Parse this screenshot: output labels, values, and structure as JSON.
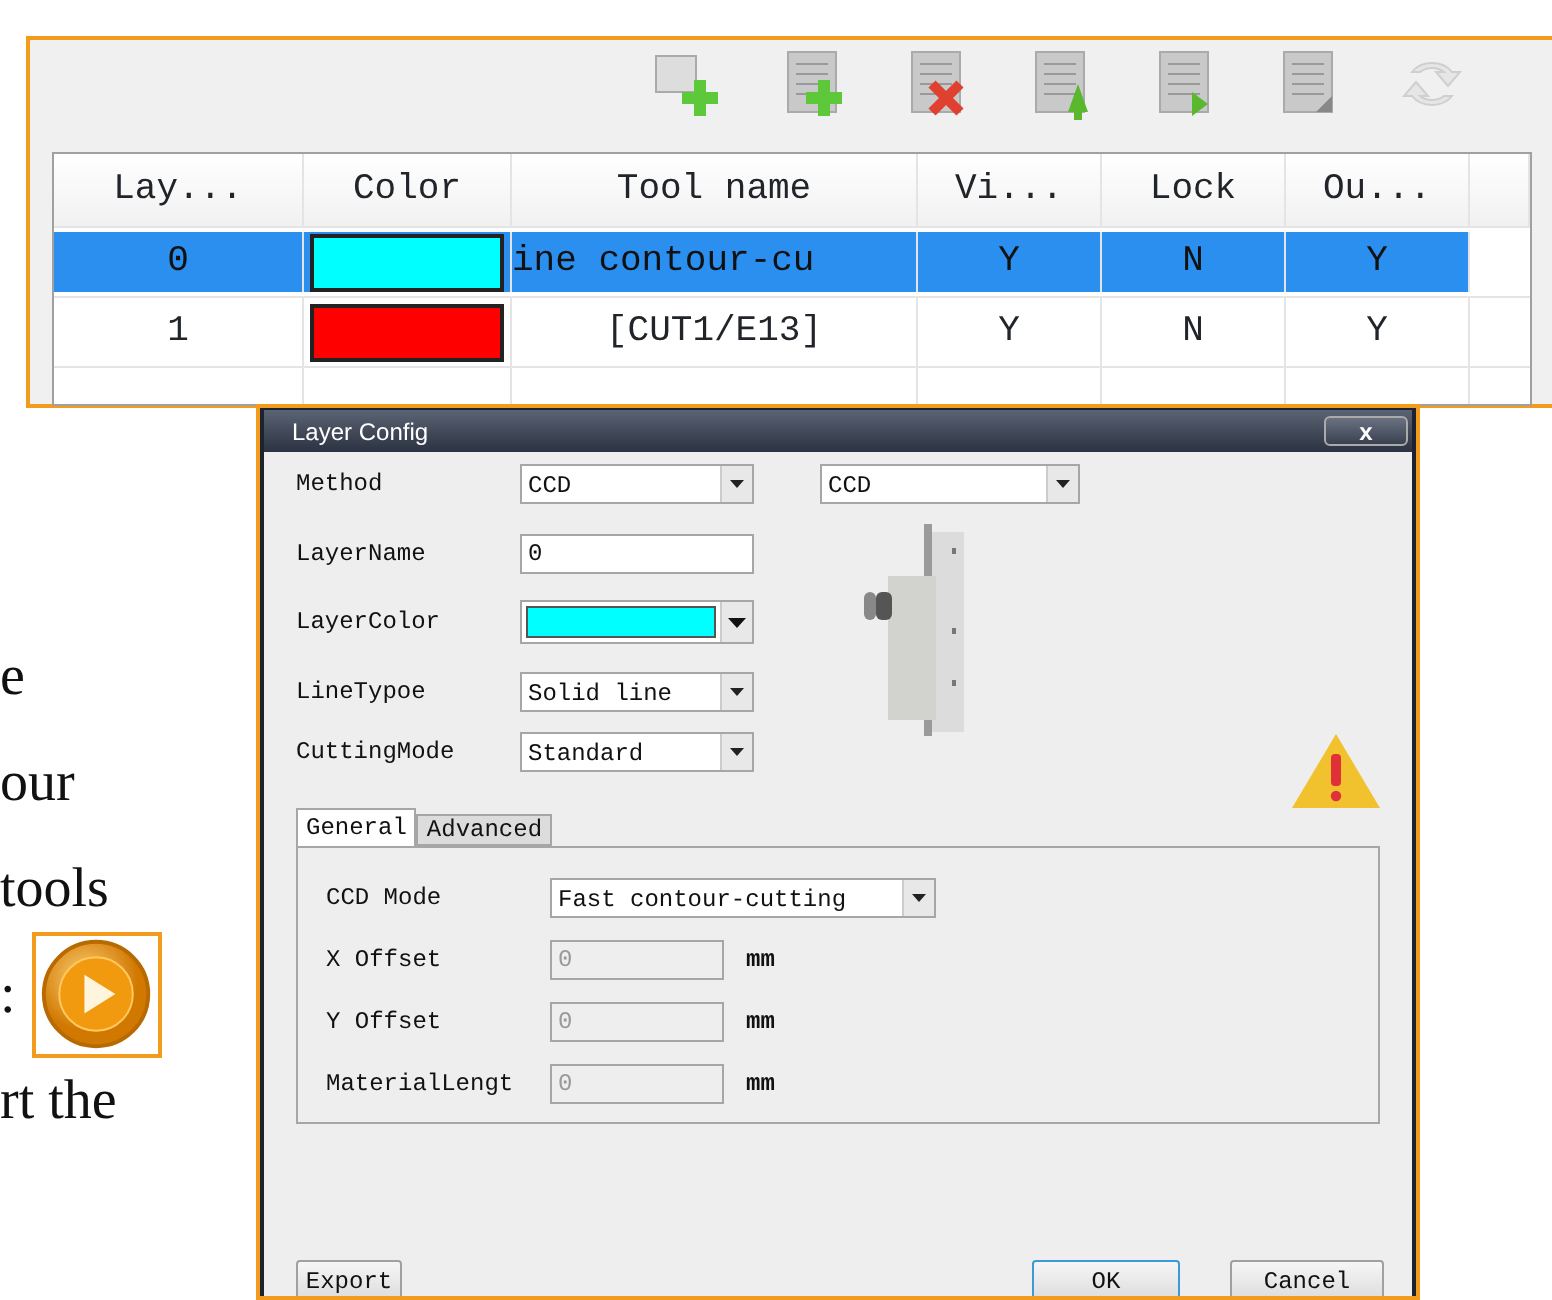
{
  "layers_panel": {
    "columns": [
      "Lay...",
      "Color",
      "Tool name",
      "Vi...",
      "Lock",
      "Ou..."
    ],
    "rows": [
      {
        "layer": "0",
        "color": "#00ffff",
        "tool_name": "ine contour-cu",
        "visible": "Y",
        "lock": "N",
        "output": "Y",
        "selected": true
      },
      {
        "layer": "1",
        "color": "#ff0000",
        "tool_name": "[CUT1/E13]",
        "visible": "Y",
        "lock": "N",
        "output": "Y",
        "selected": false
      }
    ]
  },
  "doc_text": [
    "e",
    "our",
    "tools",
    ":",
    "rt the"
  ],
  "dialog": {
    "title": "Layer Config",
    "close_label": "x",
    "method": {
      "label": "Method",
      "value": "CCD",
      "value_2": "CCD"
    },
    "layer_name": {
      "label": "LayerName",
      "value": "0"
    },
    "layer_color": {
      "label": "LayerColor",
      "color": "#00ffff"
    },
    "line_type": {
      "label": "LineTypoe",
      "value": "Solid line"
    },
    "cutting_mode": {
      "label": "CuttingMode",
      "value": "Standard"
    },
    "tabs": [
      {
        "label": "General",
        "selected": true
      },
      {
        "label": "Advanced",
        "selected": false
      }
    ],
    "ccd_mode": {
      "label": "CCD Mode",
      "value": "Fast contour-cutting"
    },
    "offsets": [
      {
        "label": "X Offset",
        "value": "0",
        "unit": "mm",
        "disabled": true
      },
      {
        "label": "Y Offset",
        "value": "0",
        "unit": "mm",
        "disabled": true
      },
      {
        "label": "MaterialLengt",
        "value": "0",
        "unit": "mm",
        "disabled": true
      }
    ],
    "buttons": [
      {
        "label": "Export",
        "default": false
      },
      {
        "label": "OK",
        "default": true
      },
      {
        "label": "Cancel",
        "default": false
      }
    ]
  }
}
